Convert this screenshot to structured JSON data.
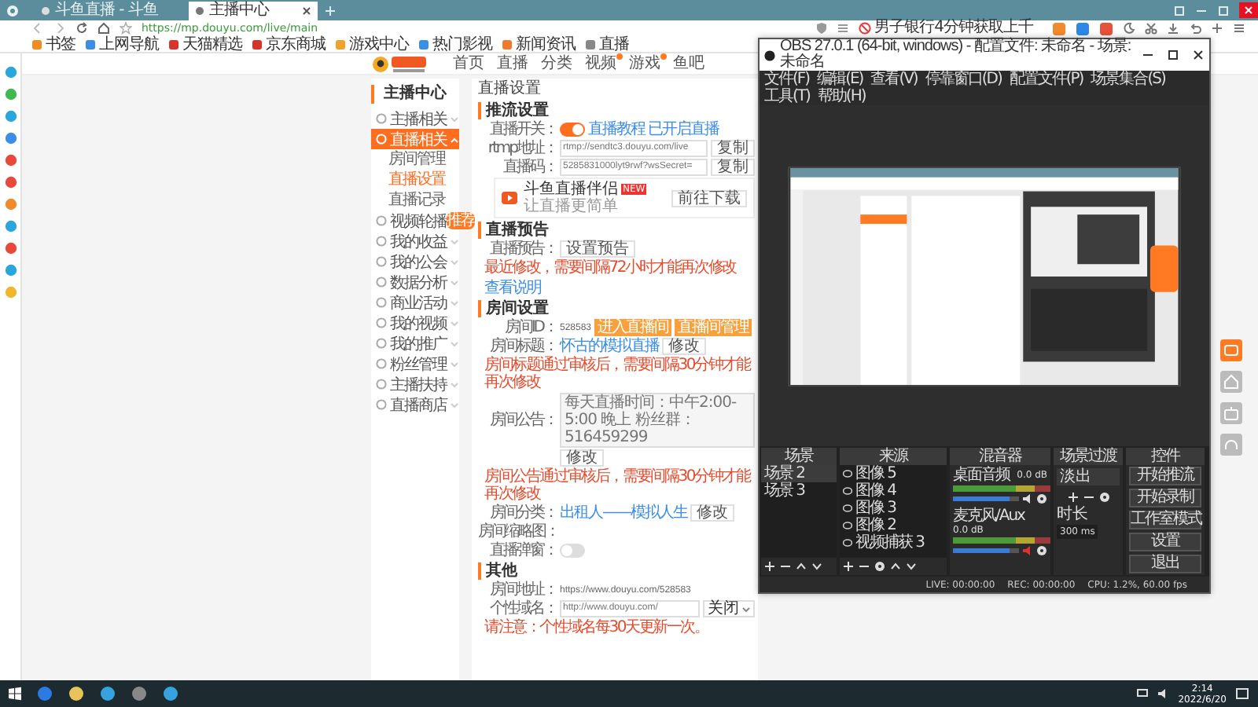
{
  "browser": {
    "tabs": [
      {
        "title": "斗鱼直播 - 斗鱼",
        "selected": false
      },
      {
        "title": "主播中心",
        "selected": true
      }
    ],
    "url": "https://mp.douyu.com/live/main",
    "news": "男子银行4分钟获取上千",
    "bookmarks": [
      "书签",
      "上网导航",
      "天猫精选",
      "京东商城",
      "游戏中心",
      "热门影视",
      "新闻资讯",
      "直播"
    ]
  },
  "site_nav": {
    "items": [
      {
        "label": "首页",
        "badge": false
      },
      {
        "label": "直播",
        "badge": false
      },
      {
        "label": "分类",
        "badge": false
      },
      {
        "label": "视频",
        "badge": true
      },
      {
        "label": "游戏",
        "badge": true
      },
      {
        "label": "鱼吧",
        "badge": false
      }
    ]
  },
  "sidebar": {
    "title": "主播中心",
    "items": [
      {
        "label": "主播相关",
        "selected": false,
        "expanded": false
      },
      {
        "label": "直播相关",
        "selected": true,
        "expanded": true,
        "children": [
          {
            "label": "房间管理",
            "selected": false
          },
          {
            "label": "直播设置",
            "selected": true
          },
          {
            "label": "直播记录",
            "selected": false
          }
        ]
      },
      {
        "label": "视频轮播",
        "selected": false,
        "expanded": false,
        "tag": "推荐"
      },
      {
        "label": "我的收益",
        "selected": false,
        "expanded": false
      },
      {
        "label": "我的公会",
        "selected": false,
        "expanded": false
      },
      {
        "label": "数据分析",
        "selected": false,
        "expanded": false
      },
      {
        "label": "商业活动",
        "selected": false,
        "expanded": false
      },
      {
        "label": "我的视频",
        "selected": false,
        "expanded": false
      },
      {
        "label": "我的推广",
        "selected": false,
        "expanded": false
      },
      {
        "label": "粉丝管理",
        "selected": false,
        "expanded": false
      },
      {
        "label": "主播扶持",
        "selected": false,
        "expanded": false
      },
      {
        "label": "直播商店",
        "selected": false,
        "expanded": false
      }
    ]
  },
  "content": {
    "page_title": "直播设置",
    "stream": {
      "heading": "推流设置",
      "switch_label": "直播开关：",
      "switch_on": true,
      "links": [
        "直播教程",
        "已开启直播"
      ],
      "rtmp_label": "rtmp地址：",
      "rtmp_value": "rtmp://sendtc3.douyu.com/live",
      "rtmp_button": "复制",
      "code_label": "直播码：",
      "code_value": "5285831000lyt9rwf?wsSecret=",
      "code_button": "复制"
    },
    "promo": {
      "title": "斗鱼直播伴侣",
      "badge": "NEW",
      "subtitle": "让直播更简单",
      "button": "前往下载"
    },
    "preview": {
      "heading": "直播预告",
      "label": "直播预告：",
      "button": "设置预告",
      "note": "最近修改，需要间隔72小时才能再次修改",
      "link": "查看说明"
    },
    "room": {
      "heading": "房间设置",
      "id_label": "房间ID：",
      "id_value": "528583",
      "buttons": [
        "进入直播间",
        "直播间管理"
      ],
      "title_label": "房间标题：",
      "title_value": "怀古的模拟直播",
      "title_button": "修改",
      "title_note": "房间标题通过审核后，需要间隔30分钟才能再次修改",
      "notice_label": "房间公告：",
      "notice_value": "每天直播时间：中午2:00-5:00 晚上 粉丝群：516459299",
      "notice_button": "修改",
      "notice_note": "房间公告通过审核后，需要间隔30分钟才能再次修改",
      "category_label": "房间分类：",
      "category_value": "出租人——模拟人生",
      "category_button": "修改",
      "thumb_label": "房间缩略图：",
      "popup_label": "直播弹窗：",
      "popup_on": false
    },
    "other": {
      "heading": "其他",
      "address_label": "房间地址：",
      "address_value": "https://www.douyu.com/528583",
      "domain_label": "个性域名：",
      "domain_value": "http://www.douyu.com/",
      "domain_select": "关闭",
      "domain_note": "请注意：个性域名每30天更新一次。"
    }
  },
  "obs": {
    "title": "OBS 27.0.1 (64-bit, windows) - 配置文件: 未命名 - 场景: 未命名",
    "menus": [
      "文件(F)",
      "编辑(E)",
      "查看(V)",
      "停靠窗口(D)",
      "配置文件(P)",
      "场景集合(S)",
      "工具(T)",
      "帮助(H)"
    ],
    "docks": [
      "场景",
      "来源",
      "混音器",
      "场景过渡",
      "控件"
    ],
    "scenes": [
      {
        "label": "场景 2",
        "selected": true
      },
      {
        "label": "场景 3",
        "selected": false
      }
    ],
    "sources": [
      "图像 5",
      "图像 4",
      "图像 3",
      "图像 2",
      "视频捕获 3"
    ],
    "mixer": [
      {
        "name": "桌面音频",
        "reading": "0.0 dB",
        "muted": false,
        "level": 0.85
      },
      {
        "name": "麦克风/Aux",
        "reading": "0.0 dB",
        "muted": true,
        "level": 0.85
      }
    ],
    "transition": {
      "value": "淡出",
      "duration_label": "时长",
      "duration": "300 ms"
    },
    "controls": [
      "开始推流",
      "开始录制",
      "工作室模式",
      "设置",
      "退出"
    ],
    "status": [
      "LIVE: 00:00:00",
      "REC: 00:00:00",
      "CPU: 1.2%, 60.00 fps"
    ]
  },
  "taskbar": {
    "time": "2:14",
    "date": "2022/6/20"
  }
}
